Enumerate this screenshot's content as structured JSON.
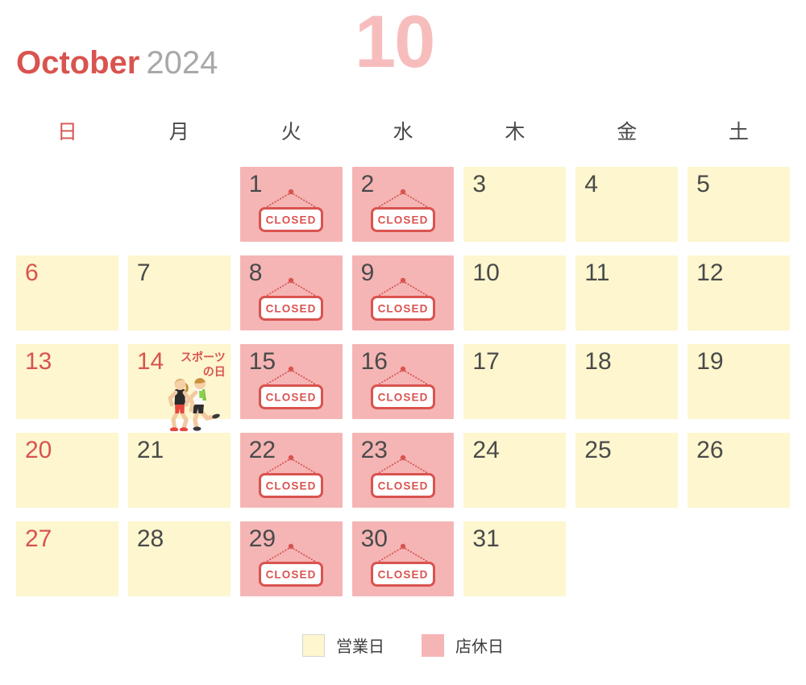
{
  "header": {
    "month_name": "October",
    "year": "2024",
    "month_number": "10"
  },
  "weekdays": [
    {
      "label": "日",
      "kind": "sun"
    },
    {
      "label": "月",
      "kind": "weekday"
    },
    {
      "label": "火",
      "kind": "weekday"
    },
    {
      "label": "水",
      "kind": "weekday"
    },
    {
      "label": "木",
      "kind": "weekday"
    },
    {
      "label": "金",
      "kind": "weekday"
    },
    {
      "label": "土",
      "kind": "weekday"
    }
  ],
  "closed_sign_label": "CLOSED",
  "holiday": {
    "date": "14",
    "name_line1": "スポーツ",
    "name_line2": "の日"
  },
  "legend": [
    {
      "label": "営業日",
      "kind": "open",
      "color": "#FDF6CE"
    },
    {
      "label": "店休日",
      "kind": "closed",
      "color": "#F5B5B5"
    }
  ],
  "colors": {
    "accent_red": "#D9534F",
    "watermark_pink": "#F7BDBD",
    "open_cell": "#FDF6CE",
    "closed_cell": "#F5B5B5",
    "date_gray": "#4A4A4A",
    "year_gray": "#A8A8A8"
  },
  "weeks": [
    [
      {
        "day": "",
        "status": "empty"
      },
      {
        "day": "",
        "status": "empty"
      },
      {
        "day": "1",
        "status": "closed"
      },
      {
        "day": "2",
        "status": "closed"
      },
      {
        "day": "3",
        "status": "open"
      },
      {
        "day": "4",
        "status": "open"
      },
      {
        "day": "5",
        "status": "open"
      }
    ],
    [
      {
        "day": "6",
        "status": "open",
        "red": true
      },
      {
        "day": "7",
        "status": "open"
      },
      {
        "day": "8",
        "status": "closed"
      },
      {
        "day": "9",
        "status": "closed"
      },
      {
        "day": "10",
        "status": "open"
      },
      {
        "day": "11",
        "status": "open"
      },
      {
        "day": "12",
        "status": "open"
      }
    ],
    [
      {
        "day": "13",
        "status": "open",
        "red": true
      },
      {
        "day": "14",
        "status": "open",
        "red": true,
        "holiday": true
      },
      {
        "day": "15",
        "status": "closed"
      },
      {
        "day": "16",
        "status": "closed"
      },
      {
        "day": "17",
        "status": "open"
      },
      {
        "day": "18",
        "status": "open"
      },
      {
        "day": "19",
        "status": "open"
      }
    ],
    [
      {
        "day": "20",
        "status": "open",
        "red": true
      },
      {
        "day": "21",
        "status": "open"
      },
      {
        "day": "22",
        "status": "closed"
      },
      {
        "day": "23",
        "status": "closed"
      },
      {
        "day": "24",
        "status": "open"
      },
      {
        "day": "25",
        "status": "open"
      },
      {
        "day": "26",
        "status": "open"
      }
    ],
    [
      {
        "day": "27",
        "status": "open",
        "red": true
      },
      {
        "day": "28",
        "status": "open"
      },
      {
        "day": "29",
        "status": "closed"
      },
      {
        "day": "30",
        "status": "closed"
      },
      {
        "day": "31",
        "status": "open"
      },
      {
        "day": "",
        "status": "empty"
      },
      {
        "day": "",
        "status": "empty"
      }
    ]
  ]
}
